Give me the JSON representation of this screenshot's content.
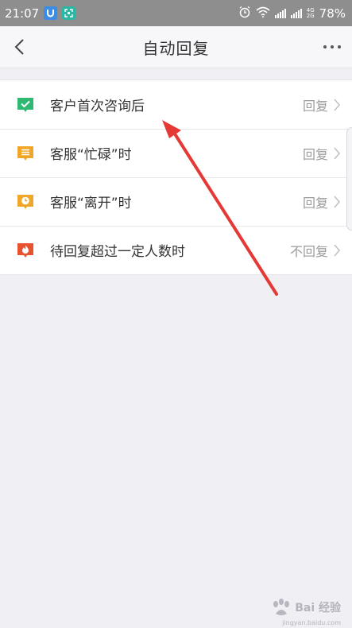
{
  "status_bar": {
    "time": "21:07",
    "battery": "78%",
    "net_top": "4G",
    "net_bottom": "2G"
  },
  "title_bar": {
    "title": "自动回复"
  },
  "rows": [
    {
      "label": "客户首次咨询后",
      "value": "回复",
      "icon": "chat-check-icon",
      "color": "#2eb872"
    },
    {
      "label": "客服“忙碌”时",
      "value": "回复",
      "icon": "chat-list-icon",
      "color": "#f0a727"
    },
    {
      "label": "客服“离开”时",
      "value": "回复",
      "icon": "chat-clock-icon",
      "color": "#f0a727"
    },
    {
      "label": "待回复超过一定人数时",
      "value": "不回复",
      "icon": "chat-fire-icon",
      "color": "#e8522f"
    }
  ],
  "annotation": {
    "color": "#e53935"
  },
  "watermark": {
    "text": "Bai 经验",
    "sub": "jingyan.baidu.com"
  }
}
